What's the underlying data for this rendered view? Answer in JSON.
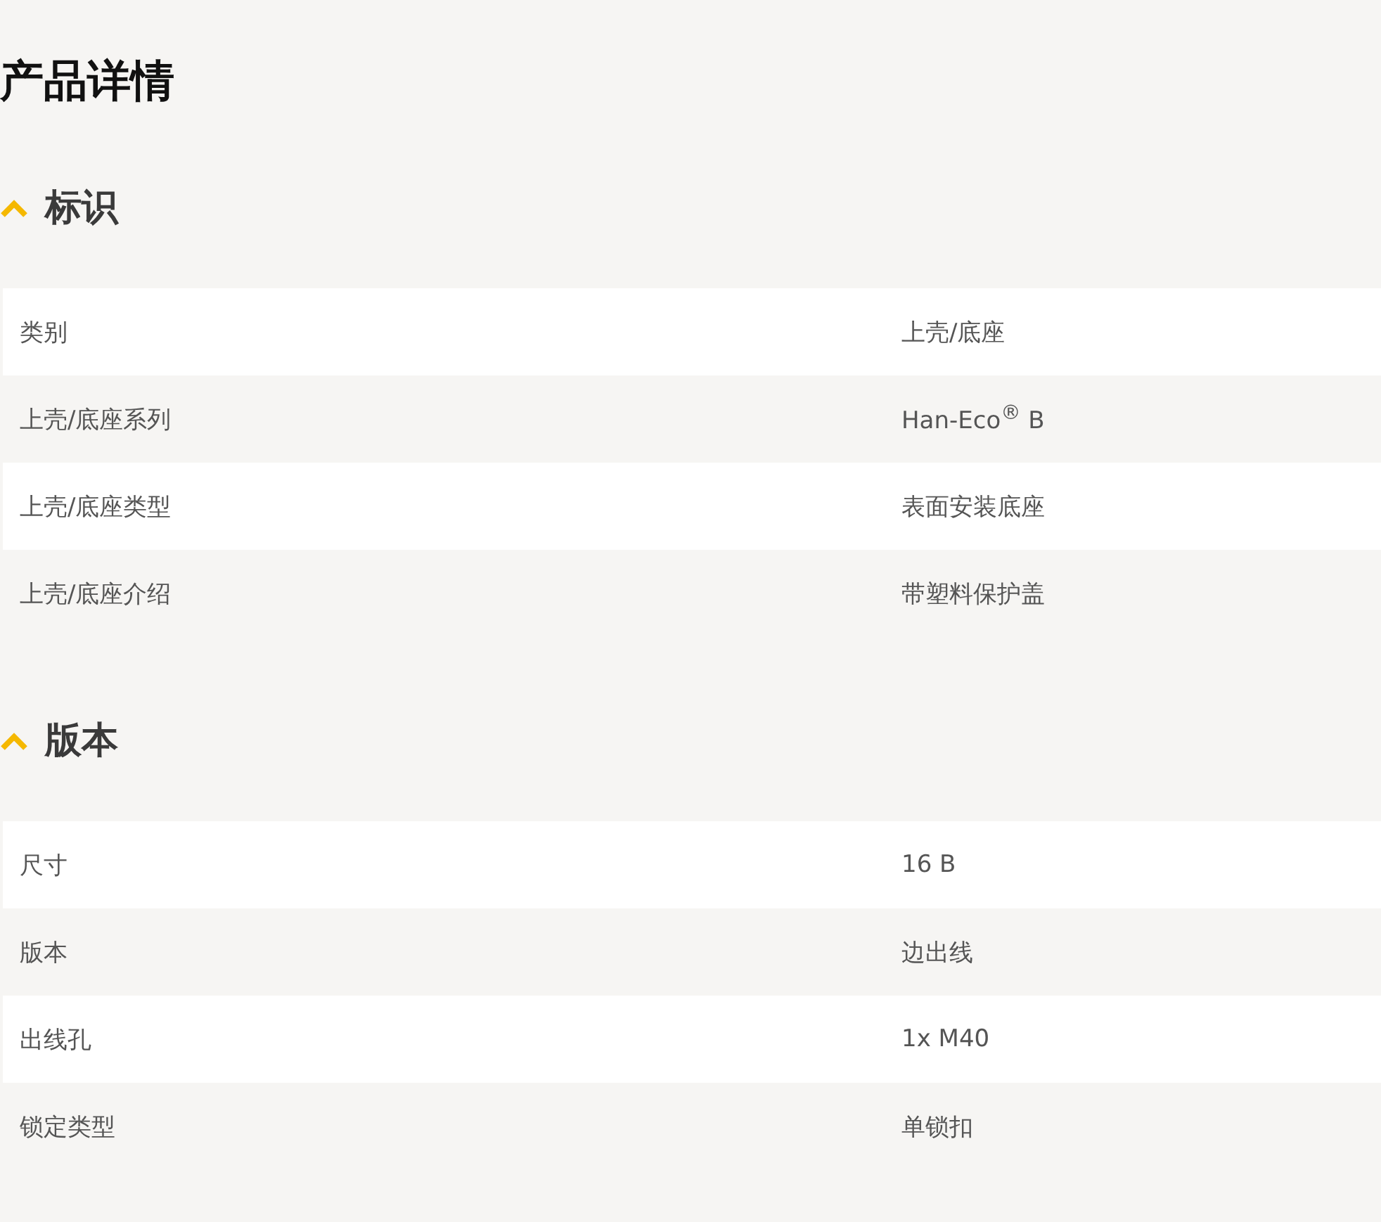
{
  "page_title": "产品详情",
  "sections": [
    {
      "title": "标识",
      "expanded": true,
      "rows": [
        {
          "label": "类别",
          "value": "上壳/底座"
        },
        {
          "label": "上壳/底座系列",
          "value": "Han-Eco$^{®}$ B"
        },
        {
          "label": "上壳/底座类型",
          "value": "表面安装底座"
        },
        {
          "label": "上壳/底座介绍",
          "value": "带塑料保护盖"
        }
      ]
    },
    {
      "title": "版本",
      "expanded": true,
      "rows": [
        {
          "label": "尺寸",
          "value": "16 B"
        },
        {
          "label": "版本",
          "value": "边出线"
        },
        {
          "label": "出线孔",
          "value": "1x M40"
        },
        {
          "label": "锁定类型",
          "value": "单锁扣"
        }
      ]
    }
  ]
}
